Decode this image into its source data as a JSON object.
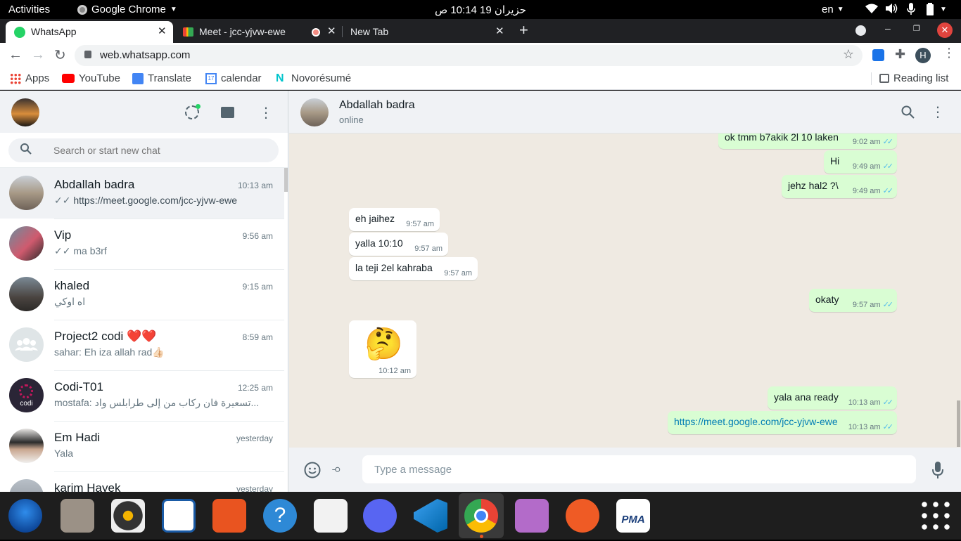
{
  "system": {
    "activities": "Activities",
    "app_menu": "Google Chrome",
    "clock": "حزيران 19  10:14 ص",
    "keyboard": "en"
  },
  "browser": {
    "tabs": [
      {
        "title": "WhatsApp",
        "active": true
      },
      {
        "title": "Meet - jcc-yjvw-ewe",
        "active": false
      },
      {
        "title": "New Tab",
        "active": false
      }
    ],
    "url": "web.whatsapp.com",
    "profile_initial": "H",
    "bookmarks": [
      "Apps",
      "YouTube",
      "Translate",
      "calendar",
      "Novorésumé"
    ],
    "calendar_day": "17",
    "reading_list": "Reading list"
  },
  "whatsapp": {
    "search_placeholder": "Search or start new chat",
    "chats": [
      {
        "name": "Abdallah badra",
        "time": "10:13 am",
        "last": "https://meet.google.com/jcc-yjvw-ewe",
        "ticks": true
      },
      {
        "name": "Vip",
        "time": "9:56 am",
        "last": "ma b3rf",
        "ticks": true
      },
      {
        "name": "khaled",
        "time": "9:15 am",
        "last": "اه اوكي",
        "ticks": false
      },
      {
        "name": "Project2 codi ❤️❤️",
        "time": "8:59 am",
        "last": "sahar: Eh iza allah rad👍🏻",
        "ticks": false
      },
      {
        "name": "Codi-T01",
        "time": "12:25 am",
        "last": "mostafa:  تسعيرة فان ركاب من إلى  طرابلس  واد...",
        "ticks": false
      },
      {
        "name": "Em Hadi",
        "time": "yesterday",
        "last": "Yala",
        "ticks": false
      },
      {
        "name": "karim Hayek",
        "time": "yesterday",
        "last": "",
        "ticks": false
      }
    ],
    "codi_logo_text": "codi",
    "contact": {
      "name": "Abdallah badra",
      "status": "online"
    },
    "messages": [
      {
        "dir": "out",
        "text": "ok tmm b7akik 2l 10 laken",
        "time": "9:02 am"
      },
      {
        "dir": "out",
        "text": "Hi",
        "time": "9:49 am"
      },
      {
        "dir": "out",
        "text": "jehz hal2 ?\\",
        "time": "9:49 am"
      },
      {
        "dir": "in",
        "text": "eh jaihez",
        "time": "9:57 am"
      },
      {
        "dir": "in",
        "text": "yalla 10:10",
        "time": "9:57 am"
      },
      {
        "dir": "in",
        "text": "la teji 2el kahraba",
        "time": "9:57 am"
      },
      {
        "dir": "out",
        "text": "okaty",
        "time": "9:57 am"
      },
      {
        "dir": "in",
        "text": "🤔",
        "time": "10:12 am"
      },
      {
        "dir": "out",
        "text": "yala ana ready",
        "time": "10:13 am"
      },
      {
        "dir": "out",
        "text": "https://meet.google.com/jcc-yjvw-ewe",
        "time": "10:13 am"
      }
    ],
    "composer_placeholder": "Type a message"
  },
  "dock": {
    "apps": [
      "thunderbird-icon",
      "files-icon",
      "rhythmbox-icon",
      "writer-icon",
      "software-icon",
      "help-icon",
      "text-editor-icon",
      "discord-icon",
      "vscode-icon",
      "chrome-icon",
      "video-icon",
      "postman-icon",
      "pma-icon",
      "app-grid-icon"
    ],
    "pma_label": "PMA"
  },
  "colors": {
    "accent_green": "#25d366",
    "outgoing_bubble": "#d9fdd3",
    "tick_blue": "#53bdeb",
    "link": "#027eb5"
  }
}
